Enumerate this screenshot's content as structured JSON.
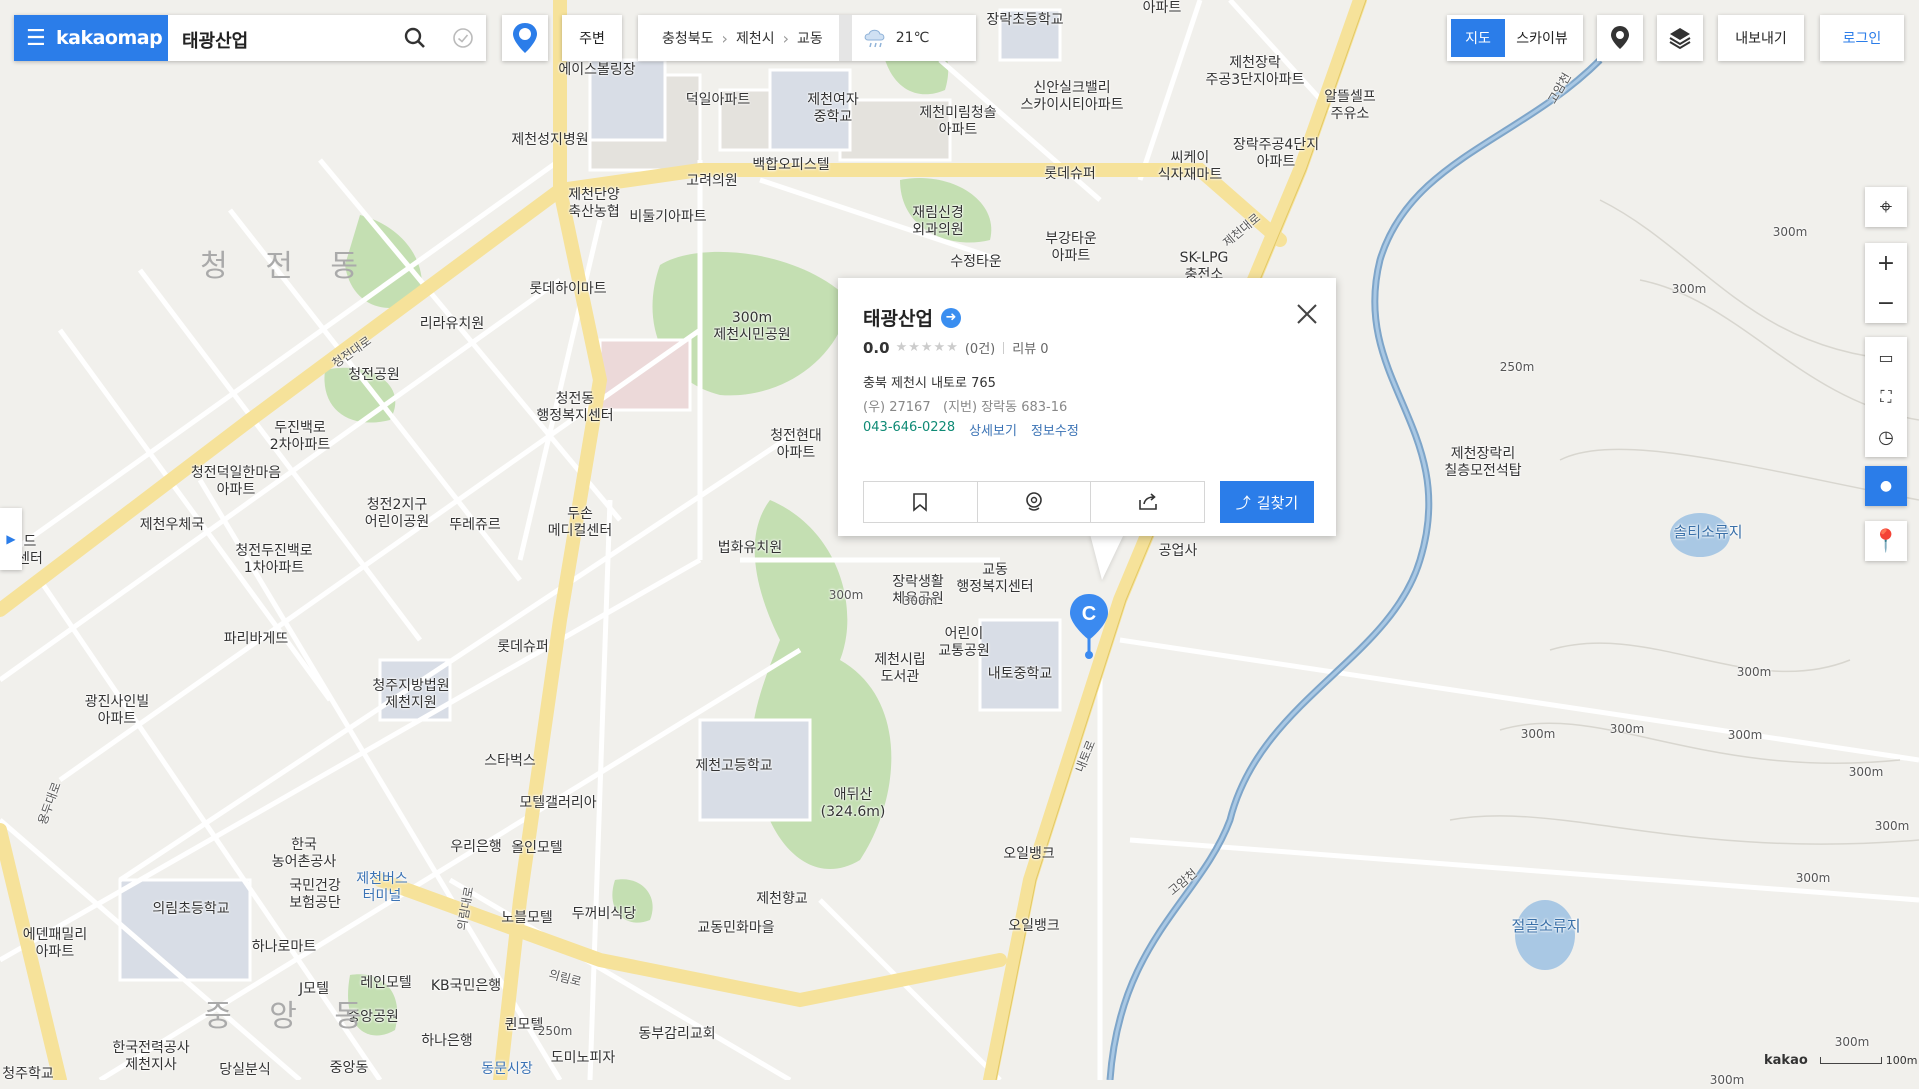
{
  "app": {
    "brand": "kakaomap",
    "search_query": "태광산업",
    "accent": "#2b7de9"
  },
  "topbar": {
    "nearby": "주변",
    "breadcrumb": [
      "충청북도",
      "제천시",
      "교동"
    ],
    "weather": "21℃",
    "map_view": "지도",
    "sky_view": "스카이뷰",
    "export": "내보내기",
    "login": "로그인"
  },
  "popup": {
    "title": "태광산업",
    "score": "0.0",
    "count": "(0건)",
    "review": "리뷰 0",
    "address": "충북 제천시 내토로 765",
    "postal": "(우) 27167",
    "jibun": "(지번) 장락동 683-16",
    "phone": "043-646-0228",
    "detail": "상세보기",
    "edit": "정보수정",
    "route": "길찾기"
  },
  "marker": {
    "letter": "C"
  },
  "labels": {
    "l01": "장락초등학교",
    "l02": "에이스볼링장",
    "l03": "덕일아파트",
    "l04": "제천여자\n중학교",
    "l05": "제천미림청솔\n아파트",
    "l06": "신안실크밸리\n스카이시티아파트",
    "l07": "제천장락\n주공3단지아파트",
    "l08": "알뜰셀프\n주유소",
    "l09": "제천성지병원",
    "l10": "고려의원",
    "l11": "백합오피스텔",
    "l12": "롯데슈퍼",
    "l13": "씨케이\n식자재마트",
    "l14": "장락주공4단지\n아파트",
    "l15": "제천단양\n축산농협",
    "l16": "비둘기아파트",
    "l17": "재림신경\n외과의원",
    "l18": "부강타운\n아파트",
    "l19": "수정타운",
    "l20": "SK-LPG\n충전소",
    "l21": "롯데하이마트",
    "l22": "리라유치원",
    "l23": "300m\n제천시민공원",
    "l24": "청전공원",
    "l25": "청전동\n행정복지센터",
    "l26": "두진백로\n2차아파트",
    "l27": "청전덕일한마음\n아파트",
    "l28": "제천우체국",
    "l29": "청전2지구\n어린이공원",
    "l30": "뚜레쥬르",
    "l31": "두손\n메디컬센터",
    "l32": "청전현대\n아파트",
    "l33": "법화유치원",
    "l34": "청전두진백로\n1차아파트",
    "l35": "장락생활\n체육공원",
    "l36": "교동\n행정복지센터",
    "l37": "공업사",
    "l38": "파리바게뜨",
    "l39": "롯데슈퍼",
    "l40": "제천시립\n도서관",
    "l41": "어린이\n교통공원",
    "l42": "내토중학교",
    "l43": "청주지방법원\n제천지원",
    "l44": "광진사인빌\n아파트",
    "l45": "스타벅스",
    "l46": "제천고등학교",
    "l47": "애뒤산\n(324.6m)",
    "l48": "모텔갤러리아",
    "l49": "한국\n농어촌공사",
    "l50": "우리은행",
    "l51": "올인모텔",
    "l52": "국민건강\n보험공단",
    "l53": "제천버스\n터미널",
    "l54": "오일뱅크",
    "l55": "의림초등학교",
    "l56": "노블모텔",
    "l57": "두꺼비식당",
    "l58": "제천향교",
    "l59": "교동민화마을",
    "l60": "오일뱅크",
    "l61": "에덴패밀리\n아파트",
    "l62": "하나로마트",
    "l63": "J모텔",
    "l64": "레인모텔",
    "l65": "KB국민은행",
    "l66": "중앙공원",
    "l67": "퀸모텔",
    "l68": "하나은행",
    "l69": "동부감리교회",
    "l70": "도미노피자",
    "l71": "한국전력공사\n제천지사",
    "l72": "당실분식",
    "l73": "중앙동",
    "l74": "동문시장",
    "l75": "청주학교",
    "l76": "제천장락리\n칠층모전석탑",
    "l77": "솔티소류지",
    "l78": "절골소류지",
    "l79": "청 전 동",
    "l80": "중 앙 동",
    "l81": "드\n센터",
    "l82": "아파트"
  },
  "contour_labels": [
    "300m",
    "300m",
    "250m",
    "300m",
    "300m",
    "300m",
    "300m",
    "300m",
    "300m",
    "300m",
    "300m",
    "300m",
    "300m",
    "300m",
    "250m"
  ],
  "road_names": [
    "청전대로",
    "내토로",
    "제천대로",
    "의림대로",
    "고암천",
    "고암천",
    "의림로",
    "용두대로"
  ],
  "scale": {
    "brand": "kakao",
    "label": "100m"
  },
  "icons": {
    "menu": "hamburger-icon",
    "search": "search-icon",
    "check": "check-circle-icon",
    "location": "pin-icon",
    "weather": "rain-cloud-icon",
    "roadview": "roadview-icon",
    "layers": "layers-icon",
    "my_location": "crosshair-icon",
    "zoom_in": "plus-icon",
    "zoom_out": "minus-icon",
    "ruler": "ruler-icon",
    "area": "area-icon",
    "radius": "radius-icon",
    "bookmark": "bookmark-icon",
    "share": "share-icon"
  }
}
